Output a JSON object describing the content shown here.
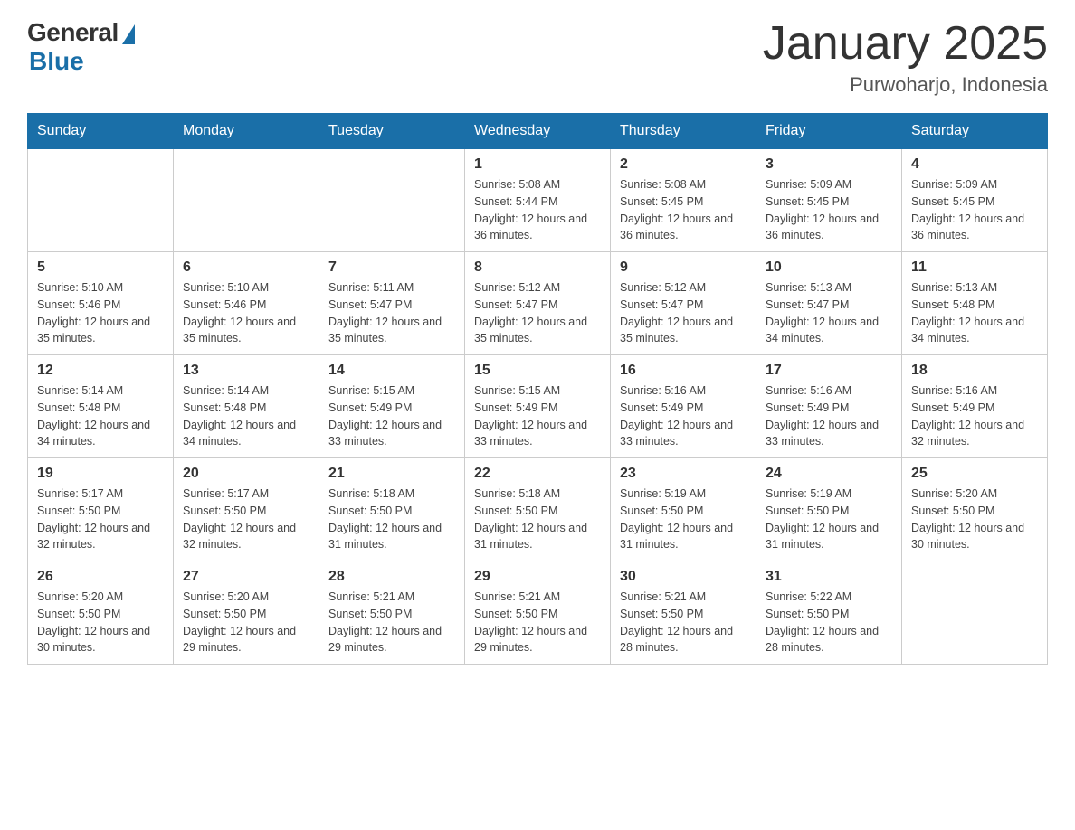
{
  "logo": {
    "general": "General",
    "blue": "Blue"
  },
  "title": "January 2025",
  "location": "Purwoharjo, Indonesia",
  "headers": [
    "Sunday",
    "Monday",
    "Tuesday",
    "Wednesday",
    "Thursday",
    "Friday",
    "Saturday"
  ],
  "weeks": [
    [
      {
        "day": "",
        "info": ""
      },
      {
        "day": "",
        "info": ""
      },
      {
        "day": "",
        "info": ""
      },
      {
        "day": "1",
        "info": "Sunrise: 5:08 AM\nSunset: 5:44 PM\nDaylight: 12 hours and 36 minutes."
      },
      {
        "day": "2",
        "info": "Sunrise: 5:08 AM\nSunset: 5:45 PM\nDaylight: 12 hours and 36 minutes."
      },
      {
        "day": "3",
        "info": "Sunrise: 5:09 AM\nSunset: 5:45 PM\nDaylight: 12 hours and 36 minutes."
      },
      {
        "day": "4",
        "info": "Sunrise: 5:09 AM\nSunset: 5:45 PM\nDaylight: 12 hours and 36 minutes."
      }
    ],
    [
      {
        "day": "5",
        "info": "Sunrise: 5:10 AM\nSunset: 5:46 PM\nDaylight: 12 hours and 35 minutes."
      },
      {
        "day": "6",
        "info": "Sunrise: 5:10 AM\nSunset: 5:46 PM\nDaylight: 12 hours and 35 minutes."
      },
      {
        "day": "7",
        "info": "Sunrise: 5:11 AM\nSunset: 5:47 PM\nDaylight: 12 hours and 35 minutes."
      },
      {
        "day": "8",
        "info": "Sunrise: 5:12 AM\nSunset: 5:47 PM\nDaylight: 12 hours and 35 minutes."
      },
      {
        "day": "9",
        "info": "Sunrise: 5:12 AM\nSunset: 5:47 PM\nDaylight: 12 hours and 35 minutes."
      },
      {
        "day": "10",
        "info": "Sunrise: 5:13 AM\nSunset: 5:47 PM\nDaylight: 12 hours and 34 minutes."
      },
      {
        "day": "11",
        "info": "Sunrise: 5:13 AM\nSunset: 5:48 PM\nDaylight: 12 hours and 34 minutes."
      }
    ],
    [
      {
        "day": "12",
        "info": "Sunrise: 5:14 AM\nSunset: 5:48 PM\nDaylight: 12 hours and 34 minutes."
      },
      {
        "day": "13",
        "info": "Sunrise: 5:14 AM\nSunset: 5:48 PM\nDaylight: 12 hours and 34 minutes."
      },
      {
        "day": "14",
        "info": "Sunrise: 5:15 AM\nSunset: 5:49 PM\nDaylight: 12 hours and 33 minutes."
      },
      {
        "day": "15",
        "info": "Sunrise: 5:15 AM\nSunset: 5:49 PM\nDaylight: 12 hours and 33 minutes."
      },
      {
        "day": "16",
        "info": "Sunrise: 5:16 AM\nSunset: 5:49 PM\nDaylight: 12 hours and 33 minutes."
      },
      {
        "day": "17",
        "info": "Sunrise: 5:16 AM\nSunset: 5:49 PM\nDaylight: 12 hours and 33 minutes."
      },
      {
        "day": "18",
        "info": "Sunrise: 5:16 AM\nSunset: 5:49 PM\nDaylight: 12 hours and 32 minutes."
      }
    ],
    [
      {
        "day": "19",
        "info": "Sunrise: 5:17 AM\nSunset: 5:50 PM\nDaylight: 12 hours and 32 minutes."
      },
      {
        "day": "20",
        "info": "Sunrise: 5:17 AM\nSunset: 5:50 PM\nDaylight: 12 hours and 32 minutes."
      },
      {
        "day": "21",
        "info": "Sunrise: 5:18 AM\nSunset: 5:50 PM\nDaylight: 12 hours and 31 minutes."
      },
      {
        "day": "22",
        "info": "Sunrise: 5:18 AM\nSunset: 5:50 PM\nDaylight: 12 hours and 31 minutes."
      },
      {
        "day": "23",
        "info": "Sunrise: 5:19 AM\nSunset: 5:50 PM\nDaylight: 12 hours and 31 minutes."
      },
      {
        "day": "24",
        "info": "Sunrise: 5:19 AM\nSunset: 5:50 PM\nDaylight: 12 hours and 31 minutes."
      },
      {
        "day": "25",
        "info": "Sunrise: 5:20 AM\nSunset: 5:50 PM\nDaylight: 12 hours and 30 minutes."
      }
    ],
    [
      {
        "day": "26",
        "info": "Sunrise: 5:20 AM\nSunset: 5:50 PM\nDaylight: 12 hours and 30 minutes."
      },
      {
        "day": "27",
        "info": "Sunrise: 5:20 AM\nSunset: 5:50 PM\nDaylight: 12 hours and 29 minutes."
      },
      {
        "day": "28",
        "info": "Sunrise: 5:21 AM\nSunset: 5:50 PM\nDaylight: 12 hours and 29 minutes."
      },
      {
        "day": "29",
        "info": "Sunrise: 5:21 AM\nSunset: 5:50 PM\nDaylight: 12 hours and 29 minutes."
      },
      {
        "day": "30",
        "info": "Sunrise: 5:21 AM\nSunset: 5:50 PM\nDaylight: 12 hours and 28 minutes."
      },
      {
        "day": "31",
        "info": "Sunrise: 5:22 AM\nSunset: 5:50 PM\nDaylight: 12 hours and 28 minutes."
      },
      {
        "day": "",
        "info": ""
      }
    ]
  ]
}
